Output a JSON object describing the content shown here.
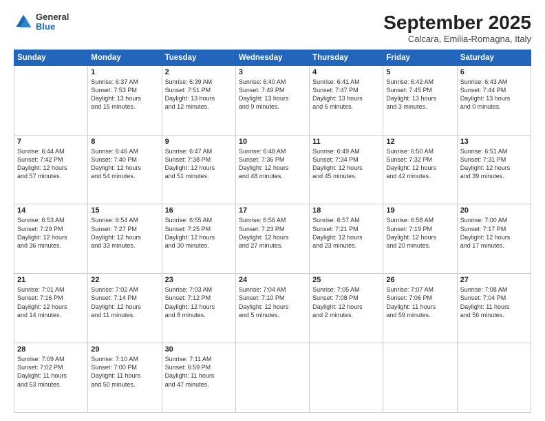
{
  "logo": {
    "general": "General",
    "blue": "Blue"
  },
  "header": {
    "month": "September 2025",
    "location": "Calcara, Emilia-Romagna, Italy"
  },
  "weekdays": [
    "Sunday",
    "Monday",
    "Tuesday",
    "Wednesday",
    "Thursday",
    "Friday",
    "Saturday"
  ],
  "weeks": [
    [
      {
        "day": "",
        "info": ""
      },
      {
        "day": "1",
        "info": "Sunrise: 6:37 AM\nSunset: 7:53 PM\nDaylight: 13 hours\nand 15 minutes."
      },
      {
        "day": "2",
        "info": "Sunrise: 6:39 AM\nSunset: 7:51 PM\nDaylight: 13 hours\nand 12 minutes."
      },
      {
        "day": "3",
        "info": "Sunrise: 6:40 AM\nSunset: 7:49 PM\nDaylight: 13 hours\nand 9 minutes."
      },
      {
        "day": "4",
        "info": "Sunrise: 6:41 AM\nSunset: 7:47 PM\nDaylight: 13 hours\nand 6 minutes."
      },
      {
        "day": "5",
        "info": "Sunrise: 6:42 AM\nSunset: 7:45 PM\nDaylight: 13 hours\nand 3 minutes."
      },
      {
        "day": "6",
        "info": "Sunrise: 6:43 AM\nSunset: 7:44 PM\nDaylight: 13 hours\nand 0 minutes."
      }
    ],
    [
      {
        "day": "7",
        "info": "Sunrise: 6:44 AM\nSunset: 7:42 PM\nDaylight: 12 hours\nand 57 minutes."
      },
      {
        "day": "8",
        "info": "Sunrise: 6:46 AM\nSunset: 7:40 PM\nDaylight: 12 hours\nand 54 minutes."
      },
      {
        "day": "9",
        "info": "Sunrise: 6:47 AM\nSunset: 7:38 PM\nDaylight: 12 hours\nand 51 minutes."
      },
      {
        "day": "10",
        "info": "Sunrise: 6:48 AM\nSunset: 7:36 PM\nDaylight: 12 hours\nand 48 minutes."
      },
      {
        "day": "11",
        "info": "Sunrise: 6:49 AM\nSunset: 7:34 PM\nDaylight: 12 hours\nand 45 minutes."
      },
      {
        "day": "12",
        "info": "Sunrise: 6:50 AM\nSunset: 7:32 PM\nDaylight: 12 hours\nand 42 minutes."
      },
      {
        "day": "13",
        "info": "Sunrise: 6:51 AM\nSunset: 7:31 PM\nDaylight: 12 hours\nand 39 minutes."
      }
    ],
    [
      {
        "day": "14",
        "info": "Sunrise: 6:53 AM\nSunset: 7:29 PM\nDaylight: 12 hours\nand 36 minutes."
      },
      {
        "day": "15",
        "info": "Sunrise: 6:54 AM\nSunset: 7:27 PM\nDaylight: 12 hours\nand 33 minutes."
      },
      {
        "day": "16",
        "info": "Sunrise: 6:55 AM\nSunset: 7:25 PM\nDaylight: 12 hours\nand 30 minutes."
      },
      {
        "day": "17",
        "info": "Sunrise: 6:56 AM\nSunset: 7:23 PM\nDaylight: 12 hours\nand 27 minutes."
      },
      {
        "day": "18",
        "info": "Sunrise: 6:57 AM\nSunset: 7:21 PM\nDaylight: 12 hours\nand 23 minutes."
      },
      {
        "day": "19",
        "info": "Sunrise: 6:58 AM\nSunset: 7:19 PM\nDaylight: 12 hours\nand 20 minutes."
      },
      {
        "day": "20",
        "info": "Sunrise: 7:00 AM\nSunset: 7:17 PM\nDaylight: 12 hours\nand 17 minutes."
      }
    ],
    [
      {
        "day": "21",
        "info": "Sunrise: 7:01 AM\nSunset: 7:16 PM\nDaylight: 12 hours\nand 14 minutes."
      },
      {
        "day": "22",
        "info": "Sunrise: 7:02 AM\nSunset: 7:14 PM\nDaylight: 12 hours\nand 11 minutes."
      },
      {
        "day": "23",
        "info": "Sunrise: 7:03 AM\nSunset: 7:12 PM\nDaylight: 12 hours\nand 8 minutes."
      },
      {
        "day": "24",
        "info": "Sunrise: 7:04 AM\nSunset: 7:10 PM\nDaylight: 12 hours\nand 5 minutes."
      },
      {
        "day": "25",
        "info": "Sunrise: 7:05 AM\nSunset: 7:08 PM\nDaylight: 12 hours\nand 2 minutes."
      },
      {
        "day": "26",
        "info": "Sunrise: 7:07 AM\nSunset: 7:06 PM\nDaylight: 11 hours\nand 59 minutes."
      },
      {
        "day": "27",
        "info": "Sunrise: 7:08 AM\nSunset: 7:04 PM\nDaylight: 11 hours\nand 56 minutes."
      }
    ],
    [
      {
        "day": "28",
        "info": "Sunrise: 7:09 AM\nSunset: 7:02 PM\nDaylight: 11 hours\nand 53 minutes."
      },
      {
        "day": "29",
        "info": "Sunrise: 7:10 AM\nSunset: 7:00 PM\nDaylight: 11 hours\nand 50 minutes."
      },
      {
        "day": "30",
        "info": "Sunrise: 7:11 AM\nSunset: 6:59 PM\nDaylight: 11 hours\nand 47 minutes."
      },
      {
        "day": "",
        "info": ""
      },
      {
        "day": "",
        "info": ""
      },
      {
        "day": "",
        "info": ""
      },
      {
        "day": "",
        "info": ""
      }
    ]
  ]
}
